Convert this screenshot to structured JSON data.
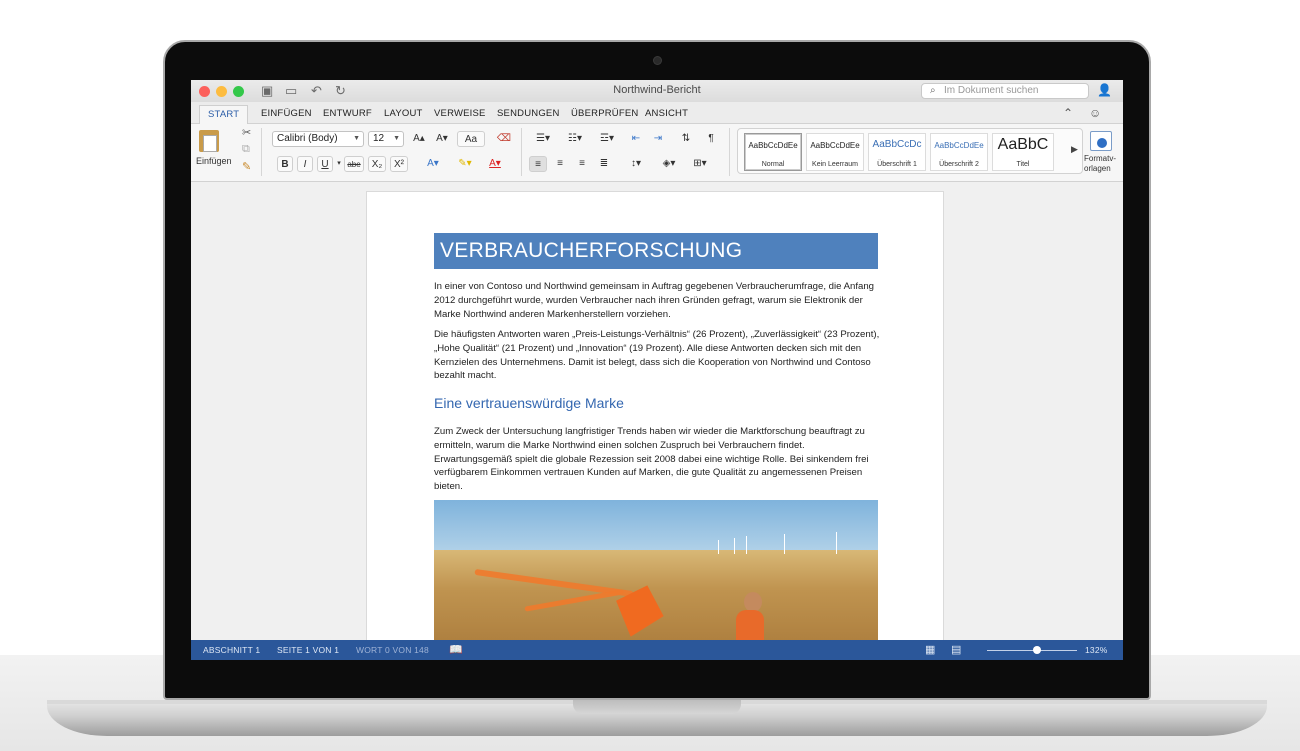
{
  "window": {
    "title": "Northwind-Bericht",
    "search_placeholder": "Im Dokument suchen",
    "colors": {
      "close": "#fc605c",
      "minimize": "#fdbc40",
      "maximize": "#34c84a"
    }
  },
  "tabs": [
    {
      "label": "START",
      "active": true
    },
    {
      "label": "EINFÜGEN"
    },
    {
      "label": "ENTWURF"
    },
    {
      "label": "LAYOUT"
    },
    {
      "label": "VERWEISE"
    },
    {
      "label": "SENDUNGEN"
    },
    {
      "label": "ÜBERPRÜFEN"
    },
    {
      "label": "ANSICHT"
    }
  ],
  "ribbon": {
    "paste_label": "Einfügen",
    "font_name": "Calibri (Body)",
    "font_size": "12",
    "format_buttons": [
      "B",
      "I",
      "U",
      "abe",
      "X₂",
      "X²"
    ],
    "grow_font": "A▴",
    "shrink_font": "A▾",
    "change_case": "Aa",
    "styles": [
      {
        "preview": "AaBbCcDdEe",
        "name": "Normal",
        "selected": true
      },
      {
        "preview": "AaBbCcDdEe",
        "name": "Kein Leerraum"
      },
      {
        "preview": "AaBbCcDc",
        "name": "Überschrift 1"
      },
      {
        "preview": "AaBbCcDdEe",
        "name": "Überschrift 2"
      },
      {
        "preview": "AaBbC",
        "name": "Titel"
      }
    ],
    "styles_pane_label": "Formatv-orlagen"
  },
  "document": {
    "heading1": "VERBRAUCHERFORSCHUNG",
    "para1": "In einer von Contoso und Northwind gemeinsam in Auftrag gegebenen Verbraucherumfrage, die Anfang 2012 durchgeführt wurde, wurden Verbraucher nach ihren Gründen gefragt, warum sie Elektronik der Marke Northwind anderen Markenherstellern vorziehen.",
    "para2": "Die häufigsten Antworten waren „Preis-Leistungs-Verhältnis“ (26 Prozent), „Zuverlässigkeit“ (23 Prozent), „Hohe Qualität“ (21 Prozent) und „Innovation“ (19 Prozent). Alle diese Antworten decken sich mit den Kernzielen des Unternehmens. Damit ist belegt, dass sich die Kooperation von Northwind und Contoso bezahlt macht.",
    "heading2": "Eine vertrauenswürdige Marke",
    "para3": "Zum Zweck der Untersuchung langfristiger Trends haben wir wieder die Marktforschung beauftragt zu ermitteln, warum die Marke Northwind einen solchen Zuspruch bei Verbrauchern findet. Erwartungsgemäß spielt die globale Rezession seit 2008 dabei eine wichtige Rolle. Bei sinkendem frei verfügbarem Einkommen vertrauen Kunden auf Marken, die gute Qualität zu angemessenen Preisen bieten."
  },
  "status": {
    "section": "ABSCHNITT 1",
    "page": "SEITE 1 VON 1",
    "words": "WORT 0 VON 148",
    "zoom": "132%",
    "zoom_fraction": 0.55
  }
}
